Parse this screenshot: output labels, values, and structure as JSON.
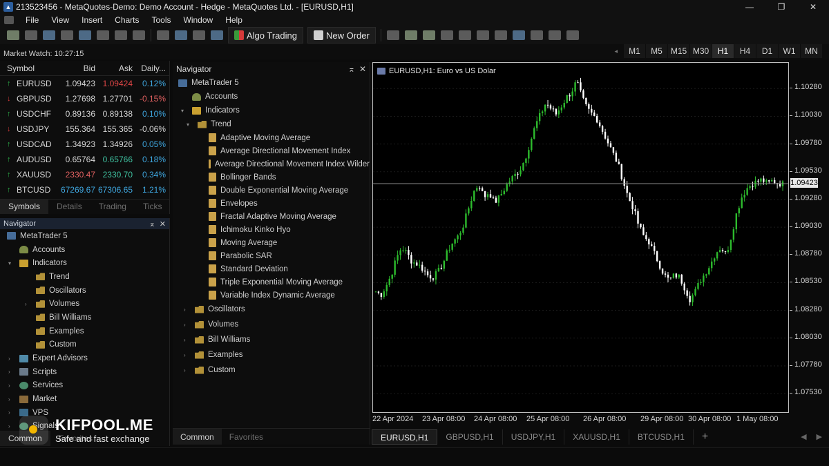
{
  "window": {
    "title": "213523456 - MetaQuotes-Demo: Demo Account - Hedge - MetaQuotes Ltd. - [EURUSD,H1]",
    "controls": [
      "—",
      "❐",
      "✕"
    ]
  },
  "menu": [
    "File",
    "View",
    "Insert",
    "Charts",
    "Tools",
    "Window",
    "Help"
  ],
  "toolbar": {
    "algo_trading": "Algo Trading",
    "new_order": "New Order"
  },
  "market_watch": {
    "time_label": "Market Watch: 10:27:15",
    "headers": {
      "symbol": "Symbol",
      "bid": "Bid",
      "ask": "Ask",
      "daily": "Daily..."
    },
    "rows": [
      {
        "symbol": "EURUSD",
        "bid": "1.09423",
        "ask": "1.09424",
        "daily": "0.12%",
        "dir": "up",
        "bid_color": "#d6d6d6",
        "ask_color": "#e04646",
        "daily_color": "#3fa7e0"
      },
      {
        "symbol": "GBPUSD",
        "bid": "1.27698",
        "ask": "1.27701",
        "daily": "-0.15%",
        "dir": "down",
        "bid_color": "#d6d6d6",
        "ask_color": "#d6d6d6",
        "daily_color": "#e06060"
      },
      {
        "symbol": "USDCHF",
        "bid": "0.89136",
        "ask": "0.89138",
        "daily": "0.10%",
        "dir": "up",
        "bid_color": "#d6d6d6",
        "ask_color": "#d6d6d6",
        "daily_color": "#3fa7e0"
      },
      {
        "symbol": "USDJPY",
        "bid": "155.364",
        "ask": "155.365",
        "daily": "-0.06%",
        "dir": "down",
        "bid_color": "#d6d6d6",
        "ask_color": "#d6d6d6",
        "daily_color": "#d6d6d6"
      },
      {
        "symbol": "USDCAD",
        "bid": "1.34923",
        "ask": "1.34926",
        "daily": "0.05%",
        "dir": "up",
        "bid_color": "#d6d6d6",
        "ask_color": "#d6d6d6",
        "daily_color": "#3fa7e0"
      },
      {
        "symbol": "AUDUSD",
        "bid": "0.65764",
        "ask": "0.65766",
        "daily": "0.18%",
        "dir": "up",
        "bid_color": "#d6d6d6",
        "ask_color": "#3fc1a0",
        "daily_color": "#3fa7e0"
      },
      {
        "symbol": "XAUUSD",
        "bid": "2330.47",
        "ask": "2330.70",
        "daily": "0.34%",
        "dir": "up",
        "bid_color": "#e06060",
        "ask_color": "#3fc1a0",
        "daily_color": "#3fa7e0"
      },
      {
        "symbol": "BTCUSD",
        "bid": "67269.67",
        "ask": "67306.65",
        "daily": "1.21%",
        "dir": "up",
        "bid_color": "#3fa7e0",
        "ask_color": "#3fa7e0",
        "daily_color": "#3fa7e0"
      }
    ],
    "tabs": [
      "Symbols",
      "Details",
      "Trading",
      "Ticks"
    ]
  },
  "navigator_small": {
    "header": "Navigator",
    "items": [
      "MetaTrader 5",
      "Accounts",
      "Indicators",
      "Trend",
      "Oscillators",
      "Volumes",
      "Bill Williams",
      "Examples",
      "Custom",
      "Expert Advisors",
      "Scripts",
      "Services",
      "Market",
      "VPS",
      "Signals"
    ],
    "tabs": [
      "Common",
      "Favorites"
    ]
  },
  "navigator_main": {
    "header": "Navigator",
    "root": "MetaTrader 5",
    "accounts": "Accounts",
    "indicators": "Indicators",
    "trend": "Trend",
    "trend_items": [
      "Adaptive Moving Average",
      "Average Directional Movement Index",
      "Average Directional Movement Index Wilder",
      "Bollinger Bands",
      "Double Exponential Moving Average",
      "Envelopes",
      "Fractal Adaptive Moving Average",
      "Ichimoku Kinko Hyo",
      "Moving Average",
      "Parabolic SAR",
      "Standard Deviation",
      "Triple Exponential Moving Average",
      "Variable Index Dynamic Average"
    ],
    "folders": [
      "Oscillators",
      "Volumes",
      "Bill Williams",
      "Examples",
      "Custom"
    ],
    "tabs": [
      "Common",
      "Favorites"
    ]
  },
  "timeframes": [
    "M1",
    "M5",
    "M15",
    "M30",
    "H1",
    "H4",
    "D1",
    "W1",
    "MN"
  ],
  "active_timeframe": "H1",
  "chart": {
    "title": "EURUSD,H1:  Euro vs US Dolar",
    "current_price": "1.09423",
    "colors": {
      "bull": "#2dbb2d",
      "bear": "#ffffff",
      "background": "#000000",
      "price_line": "#8a8a8a"
    }
  },
  "chart_data": {
    "type": "candlestick",
    "title": "EURUSD,H1:  Euro vs US Dolar",
    "ylim": [
      1.074,
      1.1045
    ],
    "yticks": [
      "1.10280",
      "1.10030",
      "1.09780",
      "1.09530",
      "1.09280",
      "1.09030",
      "1.08780",
      "1.08530",
      "1.08280",
      "1.08030",
      "1.07780",
      "1.07530"
    ],
    "xticks": [
      "22 Apr 2024",
      "23 Apr 08:00",
      "24 Apr 08:00",
      "25 Apr 08:00",
      "26 Apr 08:00",
      "29 Apr 08:00",
      "30 Apr 08:00",
      "1 May 08:00"
    ],
    "close_path": [
      1.0845,
      1.0842,
      1.085,
      1.086,
      1.0875,
      1.0885,
      1.088,
      1.0872,
      1.087,
      1.0866,
      1.086,
      1.0858,
      1.0862,
      1.087,
      1.0882,
      1.089,
      1.0895,
      1.0905,
      1.092,
      1.0935,
      1.0942,
      1.093,
      1.0935,
      1.0925,
      1.093,
      1.0938,
      1.0945,
      1.095,
      1.0955,
      1.0965,
      1.098,
      1.0995,
      1.1005,
      1.1015,
      1.101,
      1.1005,
      1.1012,
      1.102,
      1.1025,
      1.1035,
      1.102,
      1.101,
      1.1005,
      1.1,
      1.099,
      1.098,
      1.097,
      1.096,
      1.0945,
      1.093,
      1.092,
      1.0905,
      1.0895,
      1.089,
      1.088,
      1.087,
      1.086,
      1.0855,
      1.086,
      1.0858,
      1.0848,
      1.0838,
      1.0845,
      1.0855,
      1.0862,
      1.087,
      1.088,
      1.0885,
      1.0878,
      1.0895,
      1.0915,
      1.093,
      1.0938,
      1.0942,
      1.0944,
      1.0946,
      1.0942,
      1.0945,
      1.0943,
      1.0942
    ]
  },
  "chart_tabs": [
    "EURUSD,H1",
    "GBPUSD,H1",
    "USDJPY,H1",
    "XAUUSD,H1",
    "BTCUSD,H1"
  ],
  "watermark": {
    "title": "KIFPOOL.ME",
    "subtitle": "Safe and fast exchange"
  }
}
